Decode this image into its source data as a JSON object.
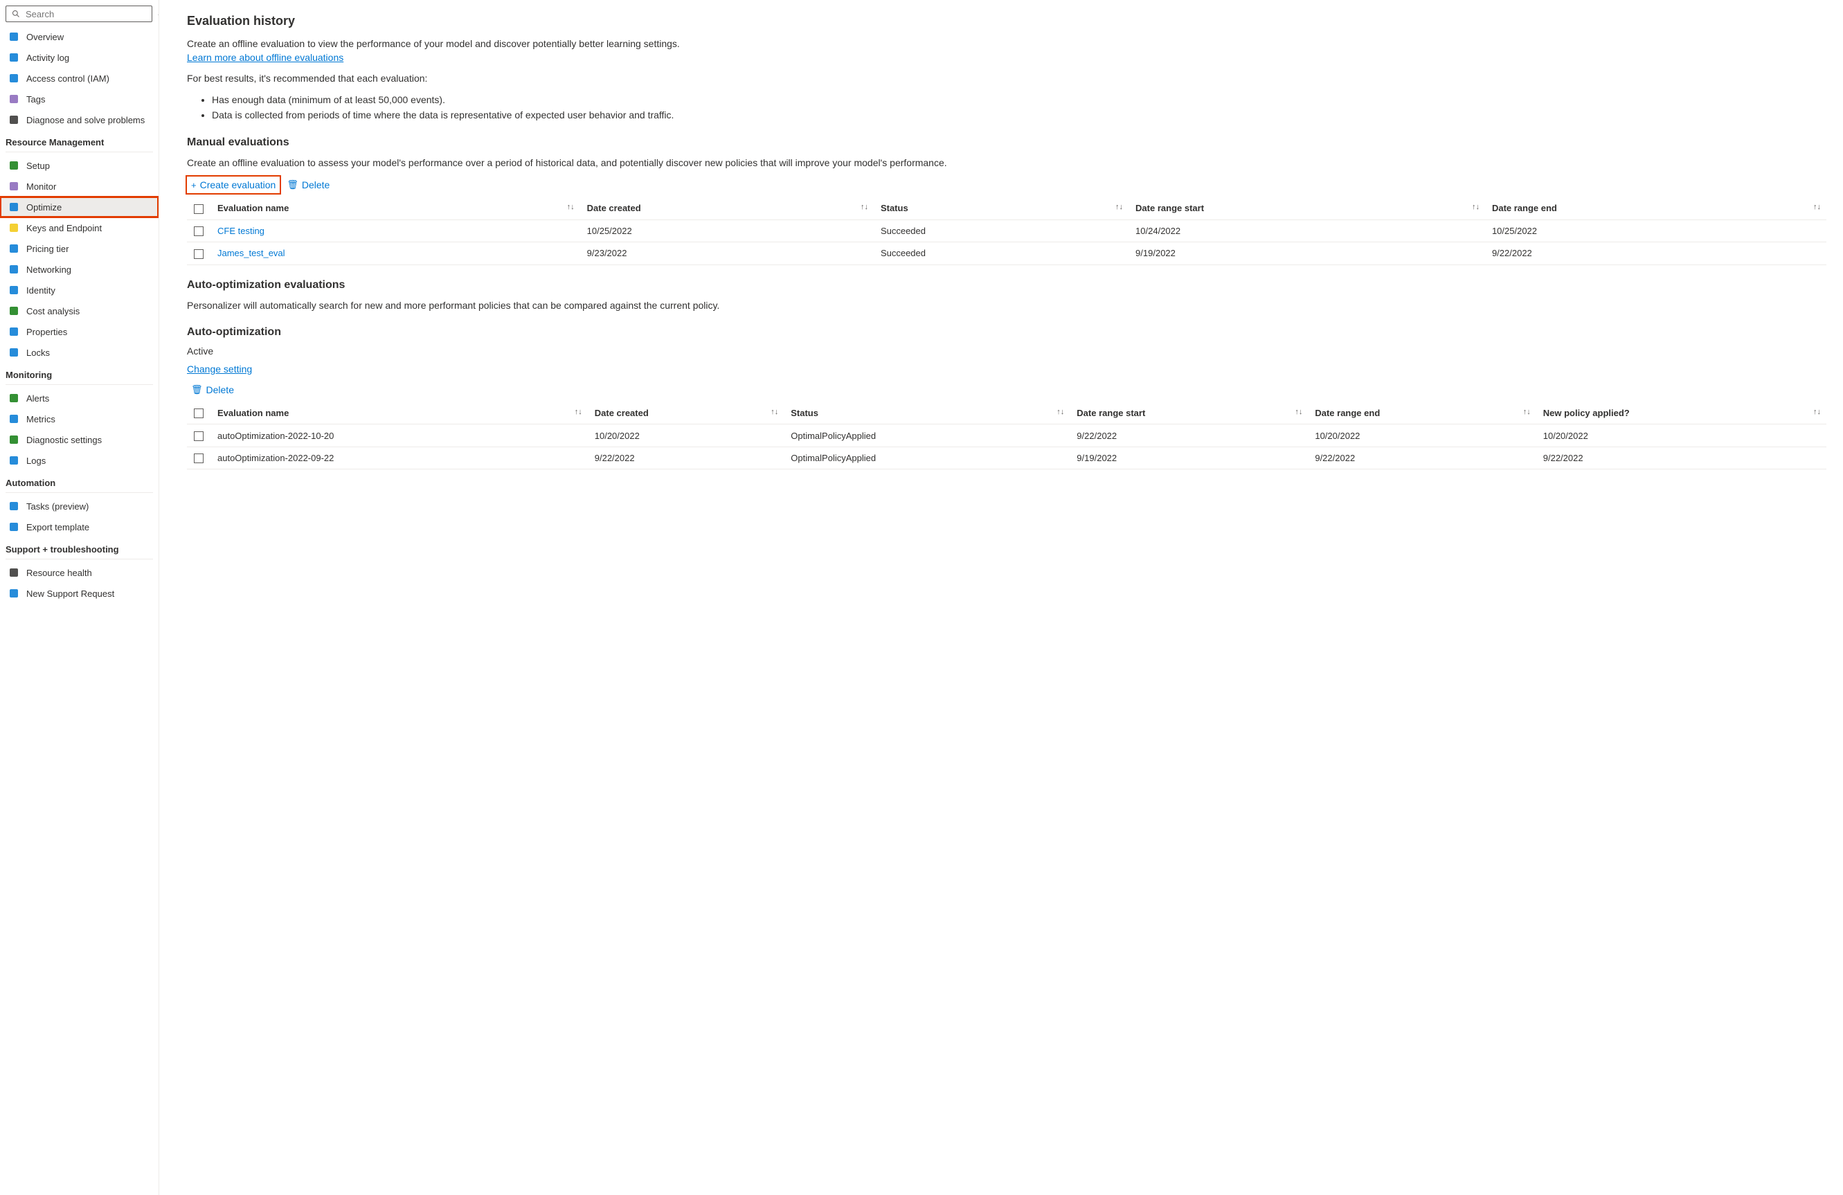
{
  "search": {
    "placeholder": "Search"
  },
  "sidebar": {
    "top": [
      {
        "label": "Overview",
        "color": "#0078d4"
      },
      {
        "label": "Activity log",
        "color": "#0078d4"
      },
      {
        "label": "Access control (IAM)",
        "color": "#0078d4"
      },
      {
        "label": "Tags",
        "color": "#8764b8"
      },
      {
        "label": "Diagnose and solve problems",
        "color": "#323130"
      }
    ],
    "sections": [
      {
        "title": "Resource Management",
        "items": [
          {
            "label": "Setup",
            "color": "#107c10"
          },
          {
            "label": "Monitor",
            "color": "#8764b8"
          },
          {
            "label": "Optimize",
            "color": "#0078d4",
            "selected": true,
            "highlighted": true
          },
          {
            "label": "Keys and Endpoint",
            "color": "#f2c811"
          },
          {
            "label": "Pricing tier",
            "color": "#0078d4"
          },
          {
            "label": "Networking",
            "color": "#0078d4"
          },
          {
            "label": "Identity",
            "color": "#0078d4"
          },
          {
            "label": "Cost analysis",
            "color": "#107c10"
          },
          {
            "label": "Properties",
            "color": "#0078d4"
          },
          {
            "label": "Locks",
            "color": "#0078d4"
          }
        ]
      },
      {
        "title": "Monitoring",
        "items": [
          {
            "label": "Alerts",
            "color": "#107c10"
          },
          {
            "label": "Metrics",
            "color": "#0078d4"
          },
          {
            "label": "Diagnostic settings",
            "color": "#107c10"
          },
          {
            "label": "Logs",
            "color": "#0078d4"
          }
        ]
      },
      {
        "title": "Automation",
        "items": [
          {
            "label": "Tasks (preview)",
            "color": "#0078d4"
          },
          {
            "label": "Export template",
            "color": "#0078d4"
          }
        ]
      },
      {
        "title": "Support + troubleshooting",
        "items": [
          {
            "label": "Resource health",
            "color": "#323130"
          },
          {
            "label": "New Support Request",
            "color": "#0078d4"
          }
        ]
      }
    ]
  },
  "page": {
    "title": "Evaluation history",
    "intro": "Create an offline evaluation to view the performance of your model and discover potentially better learning settings.",
    "learn_link": "Learn more about offline evaluations",
    "recommend_intro": "For best results, it's recommended that each evaluation:",
    "bullets": [
      "Has enough data (minimum of at least 50,000 events).",
      "Data is collected from periods of time where the data is representative of expected user behavior and traffic."
    ]
  },
  "manual": {
    "title": "Manual evaluations",
    "desc": "Create an offline evaluation to assess your model's performance over a period of historical data, and potentially discover new policies that will improve your model's performance.",
    "create_label": "Create evaluation",
    "delete_label": "Delete",
    "columns": [
      "Evaluation name",
      "Date created",
      "Status",
      "Date range start",
      "Date range end"
    ],
    "rows": [
      {
        "name": "CFE testing",
        "created": "10/25/2022",
        "status": "Succeeded",
        "start": "10/24/2022",
        "end": "10/25/2022"
      },
      {
        "name": "James_test_eval",
        "created": "9/23/2022",
        "status": "Succeeded",
        "start": "9/19/2022",
        "end": "9/22/2022"
      }
    ]
  },
  "autoEval": {
    "title": "Auto-optimization evaluations",
    "desc": "Personalizer will automatically search for new and more performant policies that can be compared against the current policy."
  },
  "autoOpt": {
    "title": "Auto-optimization",
    "status": "Active",
    "change_link": "Change setting",
    "delete_label": "Delete",
    "columns": [
      "Evaluation name",
      "Date created",
      "Status",
      "Date range start",
      "Date range end",
      "New policy applied?"
    ],
    "rows": [
      {
        "name": "autoOptimization-2022-10-20",
        "created": "10/20/2022",
        "status": "OptimalPolicyApplied",
        "start": "9/22/2022",
        "end": "10/20/2022",
        "applied": "10/20/2022"
      },
      {
        "name": "autoOptimization-2022-09-22",
        "created": "9/22/2022",
        "status": "OptimalPolicyApplied",
        "start": "9/19/2022",
        "end": "9/22/2022",
        "applied": "9/22/2022"
      }
    ]
  }
}
